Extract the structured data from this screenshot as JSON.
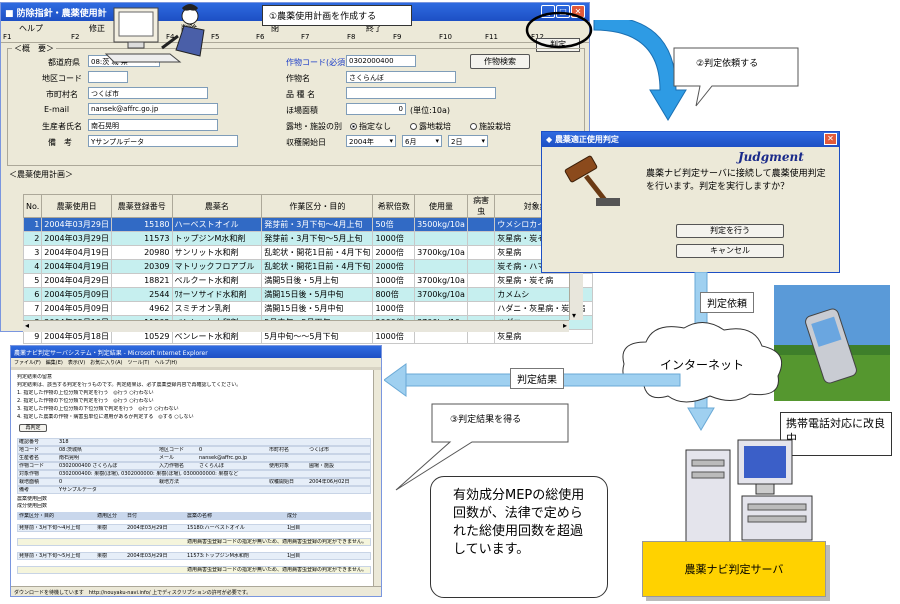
{
  "main_window": {
    "title": "防除指針・農薬使用計",
    "callout_1": "①農薬使用計画を作成する",
    "menu": [
      "ヘルプ",
      "修正",
      "削除",
      "閉",
      "終了"
    ],
    "fkeys": [
      "F1",
      "F2",
      "F3",
      "F4",
      "F5",
      "F6",
      "F7",
      "F8",
      "F9",
      "F10",
      "F11",
      "F12"
    ],
    "judge_button": "判定",
    "outline_label": "＜概　要＞",
    "fields": {
      "pref_label": "都道府県",
      "pref_value": "08:茨 城 県",
      "area_label": "地区コード",
      "area_value": "",
      "city_label": "市町村名",
      "city_value": "つくば市",
      "email_label": "E-mail",
      "email_value": "nansek@affrc.go.jp",
      "producer_label": "生産者氏名",
      "producer_value": "南石晃明",
      "remarks_label": "備　考",
      "remarks_value": "Yサンプルデータ",
      "crop_code_label": "作物コード(必須)",
      "crop_code_value": "0302000400",
      "crop_name_label": "作物名",
      "crop_name_value": "さくらんぼ",
      "variety_label": "品 種 名",
      "variety_value": "",
      "field_area_label": "ほ場面積",
      "field_area_value": "0",
      "field_area_unit": "(単位:10a)",
      "cultivation_label": "露地・施設の別",
      "cultivation_options": [
        "指定なし",
        "露地栽培",
        "施設栽培"
      ],
      "start_label": "収穫開始日",
      "start_year": "2004年",
      "start_month": "6月",
      "start_day": "2日",
      "crop_search_button": "作物検索"
    },
    "plan_label": "＜農薬使用計画＞",
    "table": {
      "headers": [
        "No.",
        "農薬使用日",
        "農薬登録番号",
        "農薬名",
        "作業区分・目的",
        "希釈倍数",
        "使用量",
        "病害虫",
        "対象病害虫"
      ],
      "rows": [
        [
          "1",
          "2004年03月29日",
          "15180",
          "ハーベストオイル",
          "発芽前・3月下旬～4月上旬",
          "50倍",
          "3500kg/10a",
          "",
          "ウメシロカイガラム"
        ],
        [
          "2",
          "2004年03月29日",
          "11573",
          "トップジンM水和剤",
          "発芽前・3月下旬～5月上旬",
          "1000倍",
          "",
          "",
          "灰星病・炭そ病"
        ],
        [
          "3",
          "2004年04月19日",
          "20980",
          "サンリット水和剤",
          "乱蛇状・開花1日前・4月下旬",
          "2000倍",
          "3700kg/10a",
          "",
          "灰星病"
        ],
        [
          "4",
          "2004年04月19日",
          "20309",
          "マトリックフロアブル",
          "乱蛇状・開花1日前・4月下旬",
          "2000倍",
          "",
          "",
          "炭そ病・ハマキムシ"
        ],
        [
          "5",
          "2004年04月29日",
          "18821",
          "ベルクート水和剤",
          "満開5日後・5月上旬",
          "1000倍",
          "3700kg/10a",
          "",
          "灰星病・炭そ病"
        ],
        [
          "6",
          "2004年05月09日",
          "2544",
          "ﾜｵーソサイド水和剤",
          "満開15日後・5月中旬",
          "800倍",
          "3700kg/10a",
          "",
          "カメムシ"
        ],
        [
          "7",
          "2004年05月09日",
          "4962",
          "スミチオン乳剤",
          "満開15日後・5月中旬",
          "1000倍",
          "",
          "",
          "ハダニ・灰星病・炭そ病"
        ],
        [
          "8",
          "2004年05月10日",
          "11502",
          "ベンレート水和剤",
          "5月中旬～5月下旬",
          "2000倍",
          "3700kg/10a",
          "",
          "ハダニ"
        ],
        [
          "9",
          "2004年05月18日",
          "10529",
          "ベンレート水和剤",
          "5月中旬～～5月下旬",
          "1000倍",
          "",
          "",
          "灰星病"
        ]
      ]
    }
  },
  "dialog": {
    "title": "農薬適正使用判定",
    "brand": "Judgment",
    "message": "農薬ナビ判定サーバに接続して農薬使用判定を行います。判定を実行しますか？",
    "ok_button": "判定を行う",
    "cancel_button": "キャンセル"
  },
  "callouts": {
    "request_judgment": "②判定依頼する",
    "get_result": "③判定結果を得る",
    "judgment_request_tag": "判定依頼",
    "judgment_result_tag": "判定結果",
    "internet": "インターネット"
  },
  "phone_note": "携帯電話対応に改良中",
  "server_label": "農薬ナビ判定サーバ",
  "note": "有効成分MEPの総使用回数が、法律で定められた総使用回数を超過しています。",
  "browser": {
    "title": "農薬ナビ判定サーバシステム・判定結果 - Microsoft Internet Explorer",
    "menu": "ファイル(F)　編集(E)　表示(V)　お気に入り(A)　ツール(T)　ヘルプ(H)",
    "lines": [
      "判定結果の留意",
      "判定結果は、該当する判定を行うものです。判定結果は、必ず農薬登録内容で再確認してください。",
      "1. 指定した作物の上位分類で判定を行う　◎行う ○行わない",
      "2. 指定した作物の下位分類で判定を行う　◎行う ○行わない",
      "3. 指定した作物の上位分類の下位分類で判定を行う　◎行う ○行わない",
      "4. 指定した農薬の作物・病害虫単位に適用があるか判定する　◎する ○しない"
    ],
    "rerun": "再判定",
    "summary": [
      [
        "確認番号",
        "318"
      ],
      [
        "地コード",
        "08:茨城県",
        "地区コード",
        "0",
        "市町村名",
        "つくば市"
      ],
      [
        "生産者名",
        "南石晃明",
        "メール",
        "nansek@affrc.go.jp"
      ],
      [
        "作物コード",
        "0302000400 さくらんぼ",
        "入力作物名",
        "さくらんぼ",
        "使用対象",
        "圃場・施設"
      ],
      [
        "対象作物",
        "0302000400: 果樹(ほ場), 0302000000: 果樹(ほ場), 0300000000: 果樹など"
      ],
      [
        "栽培面積",
        "0",
        "栽培方法",
        "",
        "収穫開始日",
        "2004年06月02日"
      ],
      [
        "備考",
        "Yサンプルデータ"
      ]
    ],
    "subtitles": [
      "農薬使用回数",
      "成分使用回数"
    ],
    "result_headers": [
      "作業区分・目的",
      "適用区分",
      "日付",
      "農薬の名称",
      "成分"
    ],
    "result_rows": [
      [
        "発芽前・3月下旬～4月上旬",
        "果樹",
        "2004年03月29日",
        "15180:ハーベストオイル",
        "1回目"
      ],
      [
        "",
        "",
        "",
        "適用病害虫登録コードの指定が無いため、適用病害虫登録の判定ができません。",
        ""
      ],
      [
        "発芽前・3月下旬～5月上旬",
        "果樹",
        "2004年03月29日",
        "11573:トップジンM水和剤",
        "1回目"
      ],
      [
        "",
        "",
        "",
        "適用病害虫登録コードの指定が無いため、適用病害虫登録の判定ができません。",
        ""
      ]
    ],
    "status": "ダウンロードを待機しています　http://nouyaku-navi.info/ 上でディスクリプションの許可が必要です。"
  }
}
